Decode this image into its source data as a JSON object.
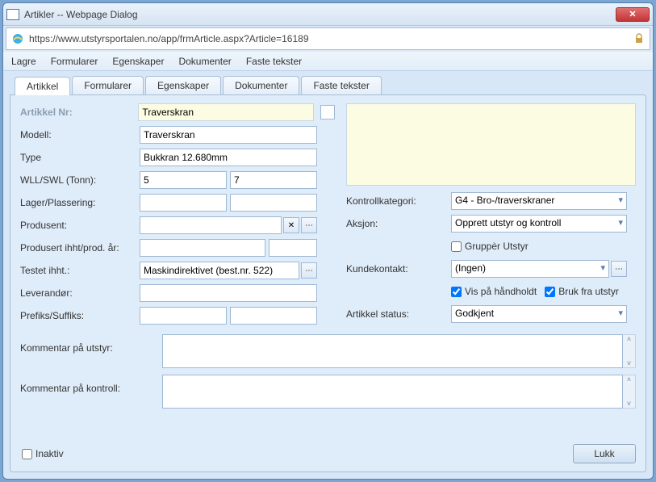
{
  "window": {
    "title": "Artikler -- Webpage Dialog"
  },
  "url": "https://www.utstyrsportalen.no/app/frmArticle.aspx?Article=16189",
  "menubar": [
    "Lagre",
    "Formularer",
    "Egenskaper",
    "Dokumenter",
    "Faste tekster"
  ],
  "tabs": [
    "Artikkel",
    "Formularer",
    "Egenskaper",
    "Dokumenter",
    "Faste tekster"
  ],
  "labels": {
    "artikkel_nr": "Artikkel Nr:",
    "modell": "Modell:",
    "type": "Type",
    "wll": "WLL/SWL (Tonn):",
    "lager": "Lager/Plassering:",
    "produsent": "Produsent:",
    "produsert": "Produsert ihht/prod. år:",
    "testet": "Testet ihht.:",
    "leverandor": "Leverandør:",
    "prefiks": "Prefiks/Suffiks:",
    "kontrollkat": "Kontrollkategori:",
    "aksjon": "Aksjon:",
    "grupper": "Gruppèr Utstyr",
    "kundekontakt": "Kundekontakt:",
    "vis": "Vis på håndholdt",
    "brukfra": "Bruk fra utstyr",
    "status": "Artikkel status:",
    "komm_utstyr": "Kommentar på utstyr:",
    "komm_kontroll": "Kommentar på kontroll:",
    "inaktiv": "Inaktiv",
    "lukk": "Lukk"
  },
  "values": {
    "artikkel_nr": "Traverskran",
    "modell": "Traverskran",
    "type": "Bukkran 12.680mm",
    "wll1": "5",
    "wll2": "7",
    "lager1": "",
    "lager2": "",
    "produsent": "",
    "produsert1": "",
    "produsert2": "",
    "testet": "Maskindirektivet (best.nr. 522)",
    "leverandor": "",
    "prefiks1": "",
    "prefiks2": "",
    "kontrollkat": "G4 - Bro-/traverskraner",
    "aksjon": "Opprett utstyr og kontroll",
    "kundekontakt": "(Ingen)",
    "status": "Godkjent",
    "grupper_chk": false,
    "vis_chk": true,
    "brukfra_chk": true,
    "inaktiv_chk": false,
    "komm_utstyr": "",
    "komm_kontroll": ""
  }
}
